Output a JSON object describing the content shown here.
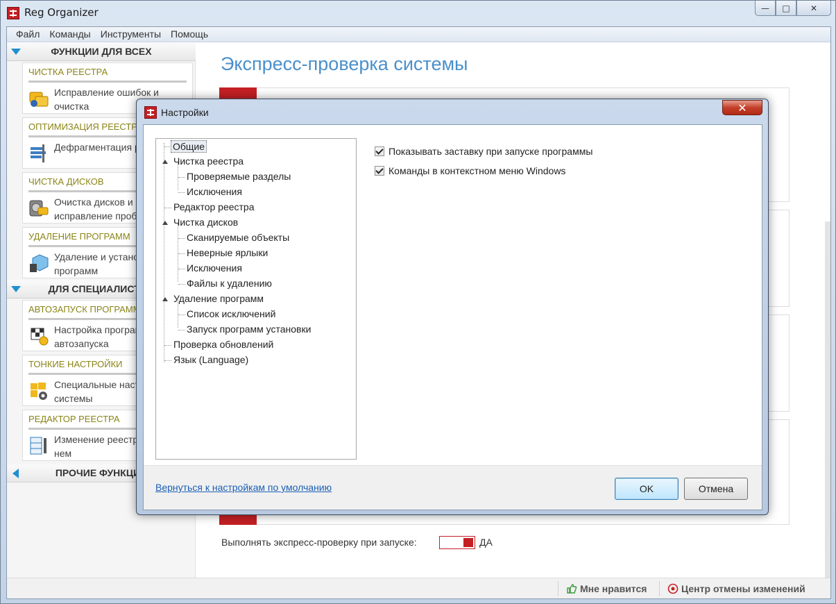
{
  "app": {
    "title": "Reg Organizer"
  },
  "caption": {
    "minimize": "—",
    "maximize": "□",
    "close": "✕"
  },
  "menu": [
    "Файл",
    "Команды",
    "Инструменты",
    "Помощь"
  ],
  "sidebar": {
    "groups": [
      {
        "label": "ФУНКЦИИ ДЛЯ ВСЕХ"
      },
      {
        "label": "ДЛЯ СПЕЦИАЛИСТОВ"
      },
      {
        "label": "ПРОЧИЕ ФУНКЦИИ"
      }
    ],
    "cards": [
      {
        "title": "ЧИСТКА РЕЕСТРА",
        "text": "Исправление ошибок и очистка",
        "icon": "registry-clean-icon"
      },
      {
        "title": "ОПТИМИЗАЦИЯ РЕЕСТРА",
        "text": "Дефрагментация реестра",
        "icon": "registry-defrag-icon"
      },
      {
        "title": "ЧИСТКА ДИСКОВ",
        "text": "Очистка дисков и исправление проблем",
        "icon": "disk-clean-icon"
      },
      {
        "title": "УДАЛЕНИЕ ПРОГРАММ",
        "text": "Удаление и установка программ",
        "icon": "uninstall-icon"
      },
      {
        "title": "АВТОЗАПУСК ПРОГРАММ",
        "text": "Настройка программ автозапуска",
        "icon": "autorun-icon"
      },
      {
        "title": "ТОНКИЕ НАСТРОЙКИ",
        "text": "Специальные настройки системы",
        "icon": "tweaks-icon"
      },
      {
        "title": "РЕДАКТОР РЕЕСТРА",
        "text": "Изменение реестра и поиск в нем",
        "icon": "registry-editor-icon"
      }
    ]
  },
  "main": {
    "title": "Экспресс-проверка системы",
    "express_label": "Выполнять экспресс-проверку при запуске:",
    "express_value": "ДА"
  },
  "statusbar": {
    "like": "Мне нравится",
    "undo_center": "Центр отмены изменений"
  },
  "dialog": {
    "title": "Настройки",
    "close": "✕",
    "tree": [
      "Общие",
      "Чистка реестра",
      "Проверяемые разделы",
      "Исключения",
      "Редактор реестра",
      "Чистка дисков",
      "Сканируемые объекты",
      "Неверные ярлыки",
      "Исключения",
      "Файлы к удалению",
      "Удаление программ",
      "Список исключений",
      "Запуск программ установки",
      "Проверка обновлений",
      "Язык (Language)"
    ],
    "options": [
      {
        "label": "Показывать заставку при запуске программы",
        "checked": true
      },
      {
        "label": "Команды в контекстном меню Windows",
        "checked": true
      }
    ],
    "reset_link": "Вернуться к настройкам по умолчанию",
    "ok": "OK",
    "cancel": "Отмена"
  }
}
